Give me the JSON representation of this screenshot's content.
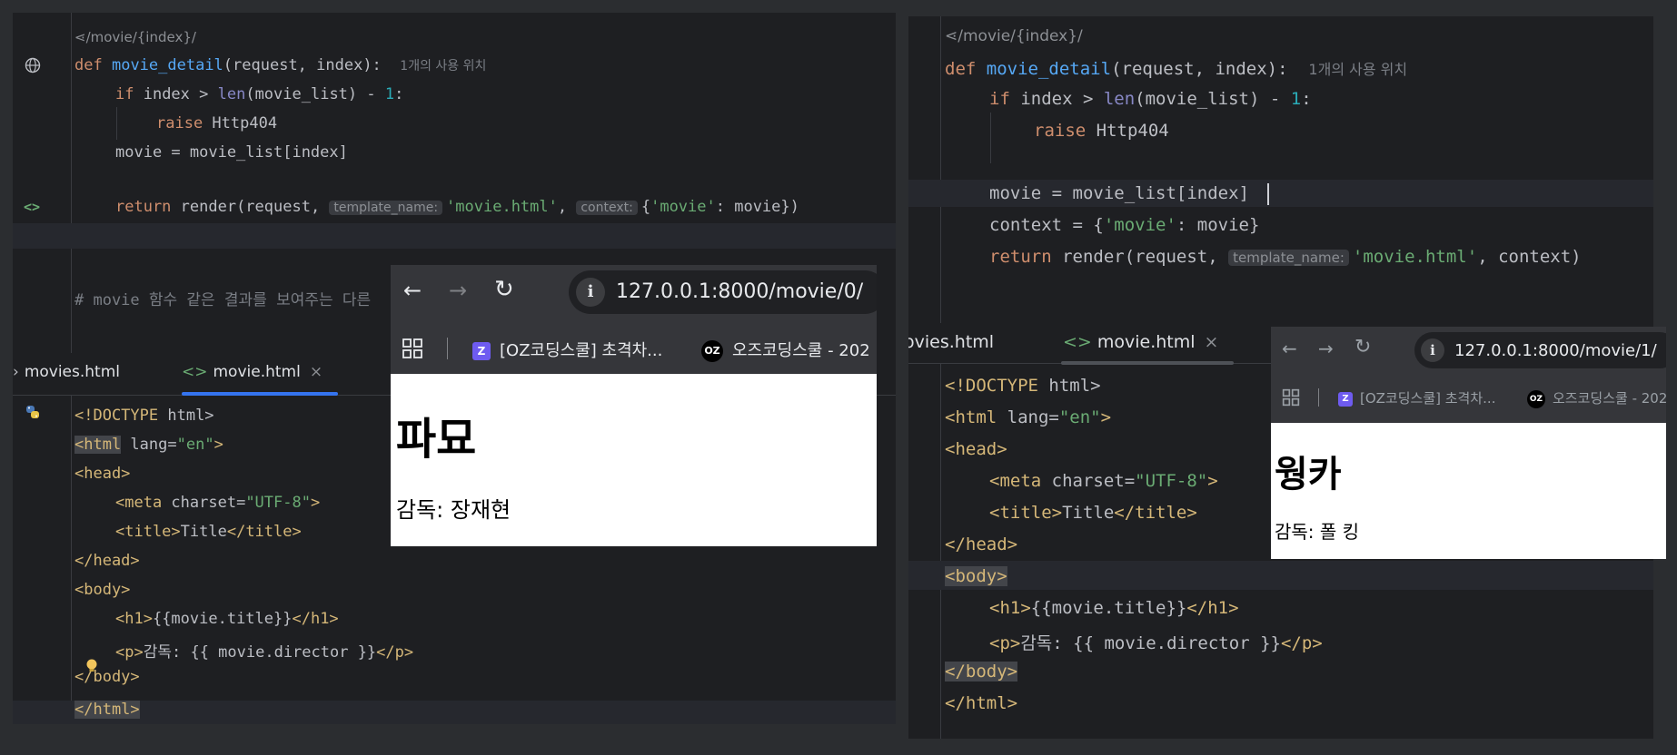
{
  "left": {
    "route_hint": "/movie/{index}/",
    "usage_hint": "1개의 사용 위치",
    "code": {
      "def_kw": "def",
      "fn_name": "movie_detail",
      "params": "(request, index):",
      "if_kw": "if",
      "cond_a": " index > ",
      "len_fn": "len",
      "cond_b": "(movie_list) - ",
      "one": "1",
      "colon": ":",
      "raise_kw": "raise",
      "raise_val": " Http404",
      "assign": "movie = movie_list[index]",
      "return_kw": "return",
      "render_open": " render(request, ",
      "template_hint": "template_name:",
      "template_val": "'movie.html'",
      "comma": ", ",
      "context_hint": "context:",
      "ctx_open": "{",
      "ctx_key": "'movie'",
      "ctx_rest": ": movie})",
      "comment": "# movie 함수 같은 결과를 보여주는 다른"
    },
    "tabs": [
      {
        "label": "movies.html",
        "active": false
      },
      {
        "label": "movie.html",
        "active": true
      }
    ],
    "html_lines": {
      "doctype_a": "<!DOCTYPE",
      "doctype_b": " html>",
      "html_tag": "<html",
      "html_attr": " lang=",
      "html_val": "\"en\"",
      "html_close": ">",
      "head_open": "<head>",
      "meta_tag": "<meta",
      "meta_attr": " charset=",
      "meta_val": "\"UTF-8\"",
      "meta_close": ">",
      "title_open": "<title>",
      "title_text": "Title",
      "title_close": "</title>",
      "head_close": "</head>",
      "body_open": "<body>",
      "h1_open": "<h1>",
      "h1_text": "{{movie.title}}",
      "h1_close": "</h1>",
      "p_open": "<p>",
      "p_text": "감독: {{ movie.director }}",
      "p_close": "</p>",
      "body_close": "</body>",
      "html_end": "</html>"
    },
    "browser": {
      "url": "127.0.0.1:8000/movie/0/",
      "bookmarks": [
        "[OZ코딩스쿨] 초격차...",
        "오즈코딩스쿨 - 202"
      ],
      "fav_z": "Z",
      "fav_oz": "OZ",
      "heading": "파묘",
      "director": "감독: 장재현"
    }
  },
  "right": {
    "route_hint": "/movie/{index}/",
    "usage_hint": "1개의 사용 위치",
    "code": {
      "assign": "movie = movie_list[index]",
      "context_line_a": "context = {",
      "context_key": "'movie'",
      "context_line_b": ": movie}",
      "render_open": " render(request, ",
      "template_hint": "template_name:",
      "template_val": "'movie.html'",
      "render_close": ", context)"
    },
    "tabs": [
      {
        "label": "ovies.html",
        "active": false
      },
      {
        "label": "movie.html",
        "active": true
      }
    ],
    "browser": {
      "url": "127.0.0.1:8000/movie/1/",
      "bookmarks": [
        "[OZ코딩스쿨] 초격차...",
        "오즈코딩스쿨 - 202"
      ],
      "fav_z": "Z",
      "fav_oz": "OZ",
      "heading": "웡카",
      "director": "감독: 폴 킹"
    }
  },
  "icons": {
    "back": "←",
    "forward": "→",
    "reload": "↻",
    "info": "i",
    "tab_html": "<>",
    "close": "×"
  }
}
